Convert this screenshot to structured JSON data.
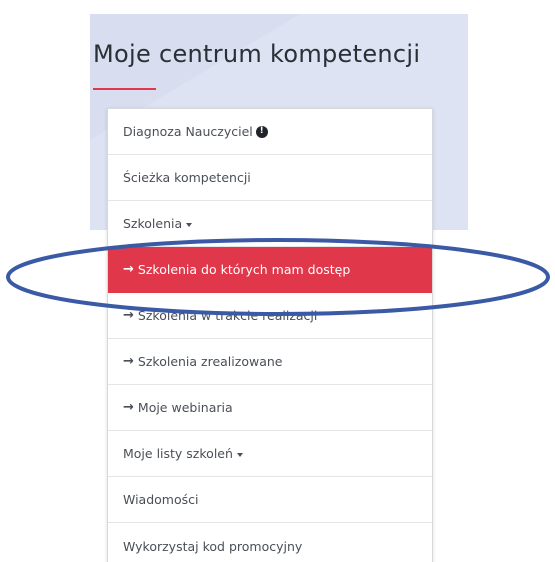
{
  "title": "Moje centrum kompetencji",
  "colors": {
    "accent": "#e0384a",
    "panel_bg": "#dde3f2",
    "annotation": "#3b5aa6"
  },
  "menu": {
    "diagnoza": {
      "label": "Diagnoza Nauczyciel",
      "icon": "info-icon"
    },
    "sciezka": {
      "label": "Ścieżka kompetencji"
    },
    "szkolenia": {
      "label": "Szkolenia",
      "icon": "caret-down-icon"
    },
    "dostep": {
      "label": "Szkolenia do których mam dostęp",
      "icon": "arrow-right-icon",
      "active": true
    },
    "w_trakcie": {
      "label": "Szkolenia w trakcie realizacji",
      "icon": "arrow-right-icon"
    },
    "zrealizowane": {
      "label": "Szkolenia zrealizowane",
      "icon": "arrow-right-icon"
    },
    "webinaria": {
      "label": "Moje webinaria",
      "icon": "arrow-right-icon"
    },
    "listy": {
      "label": "Moje listy szkoleń",
      "icon": "caret-down-icon"
    },
    "wiadomosci": {
      "label": "Wiadomości"
    },
    "kod": {
      "label": "Wykorzystaj kod promocyjny"
    }
  }
}
